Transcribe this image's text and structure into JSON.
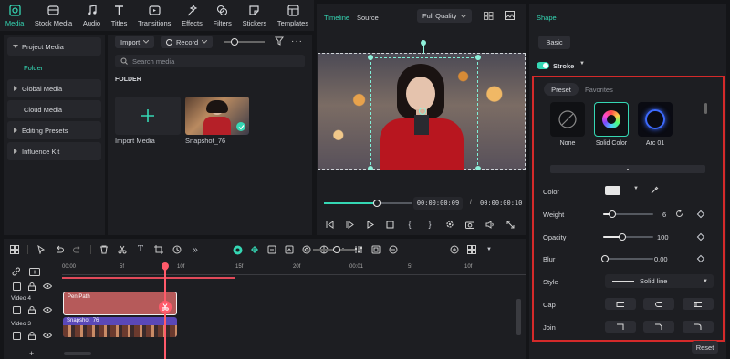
{
  "top_tabs": [
    {
      "label": "Media",
      "icon": "media-icon",
      "active": true
    },
    {
      "label": "Stock Media",
      "icon": "stock-media-icon"
    },
    {
      "label": "Audio",
      "icon": "music-note-icon"
    },
    {
      "label": "Titles",
      "icon": "titles-icon"
    },
    {
      "label": "Transitions",
      "icon": "transitions-icon"
    },
    {
      "label": "Effects",
      "icon": "effects-icon"
    },
    {
      "label": "Filters",
      "icon": "filters-icon"
    },
    {
      "label": "Stickers",
      "icon": "stickers-icon"
    },
    {
      "label": "Templates",
      "icon": "templates-icon"
    }
  ],
  "sidebar": {
    "items": [
      {
        "label": "Project Media",
        "expanded": true
      },
      {
        "label": "Folder",
        "selected": true
      },
      {
        "label": "Global Media"
      },
      {
        "label": "Cloud Media"
      },
      {
        "label": "Editing Presets"
      },
      {
        "label": "Influence Kit"
      }
    ]
  },
  "media": {
    "import_label": "Import",
    "record_label": "Record",
    "search_placeholder": "Search media",
    "folder_heading": "FOLDER",
    "import_tile_label": "Import Media",
    "clip_label": "Snapshot_76"
  },
  "viewer": {
    "tab_timeline": "Timeline",
    "tab_source": "Source",
    "quality": "Full Quality",
    "current_time": "00:00:00:09",
    "separator": "/",
    "total_time": "00:00:00:10",
    "progress": 0.6
  },
  "shape_panel": {
    "title": "Shape",
    "basic_tab": "Basic",
    "stroke_label": "Stroke",
    "stroke_on": true,
    "preset_tab": "Preset",
    "favorites_tab": "Favorites",
    "presets": [
      {
        "label": "None"
      },
      {
        "label": "Solid Color",
        "selected": true
      },
      {
        "label": "Arc 01"
      }
    ],
    "color_label": "Color",
    "color_value": "#e6e6e6",
    "weight_label": "Weight",
    "weight_value": "6",
    "opacity_label": "Opacity",
    "opacity_value": "100",
    "blur_label": "Blur",
    "blur_value": "0.00",
    "style_label": "Style",
    "style_value": "Solid line",
    "cap_label": "Cap",
    "join_label": "Join",
    "reset_label": "Reset"
  },
  "timeline": {
    "ruler": [
      "00:00",
      "5f",
      "10f",
      "15f",
      "20f",
      "00:01",
      "5f",
      "10f"
    ],
    "tracks": [
      {
        "label": "Video 4",
        "clip": "Pen Path"
      },
      {
        "label": "Video 3",
        "clip": "Snapshot_76"
      }
    ]
  },
  "colors": {
    "accent": "#35d7b4",
    "highlight_border": "#d42a2a",
    "playhead": "#ff5a6a",
    "pen_clip": "#b65a5a",
    "video_clip": "#5a48b8"
  }
}
